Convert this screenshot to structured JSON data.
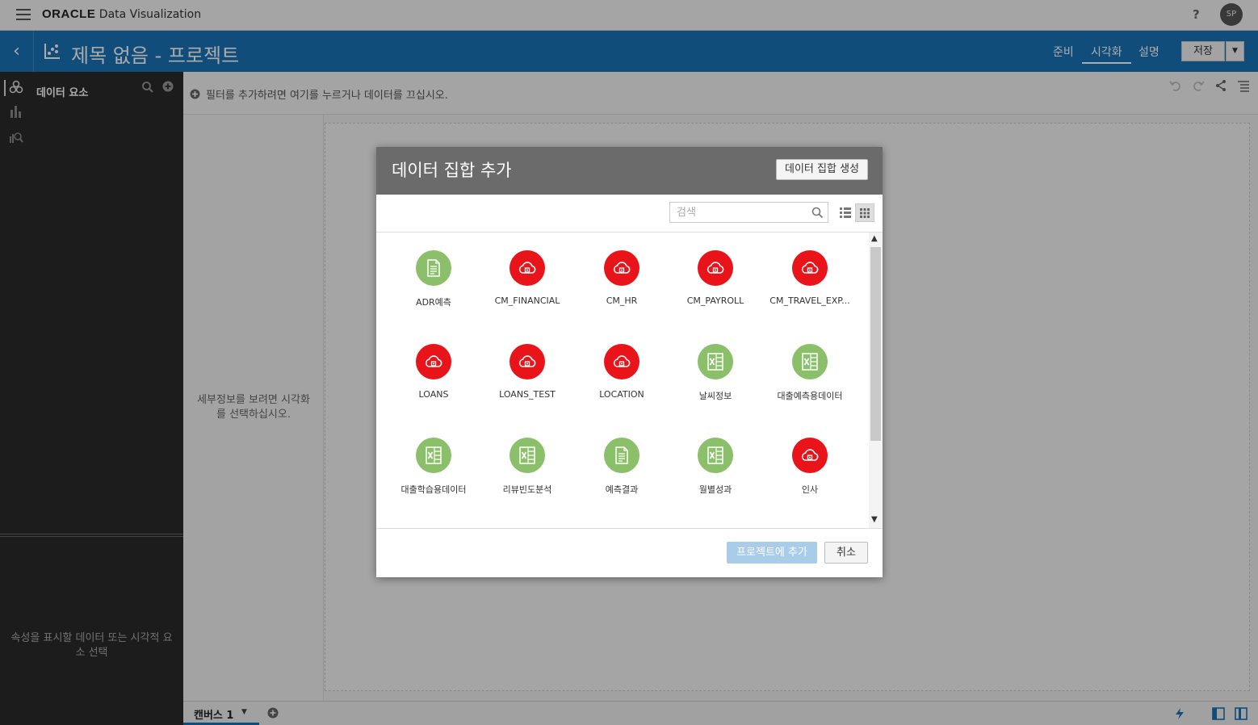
{
  "topbar": {
    "brand_oracle": "ORACLE",
    "brand_product": "Data Visualization",
    "help": "?",
    "avatar": "SP"
  },
  "titlebar": {
    "title": "제목 없음 - 프로젝트",
    "tabs": [
      {
        "label": "준비"
      },
      {
        "label": "시각화",
        "active": true
      },
      {
        "label": "설명"
      }
    ],
    "save_label": "저장",
    "save_caret": "▼"
  },
  "left_panel": {
    "section_label": "데이터 요소",
    "props_hint": "속성을 표시할 데이터 또는 시각적 요소 선택"
  },
  "filter_bar": {
    "hint": "필터를 추가하려면 여기를 누르거나 데이터를 끄십시오."
  },
  "details_pane": {
    "hint": "세부정보를 보려면 시각화를 선택하십시오."
  },
  "bottom_bar": {
    "canvas_tab": "캔버스 1",
    "caret": "▼"
  },
  "dialog": {
    "title": "데이터 집합 추가",
    "create_button": "데이터 집합 생성",
    "search_placeholder": "검색",
    "add_button": "프로젝트에 추가",
    "cancel_button": "취소",
    "datasets": [
      {
        "label": "ADR예측",
        "icon": "document-icon",
        "color": "#8bbf6a"
      },
      {
        "label": "CM_FINANCIAL",
        "icon": "cloud-icon",
        "color": "#e8141a"
      },
      {
        "label": "CM_HR",
        "icon": "cloud-icon",
        "color": "#e8141a"
      },
      {
        "label": "CM_PAYROLL",
        "icon": "cloud-icon",
        "color": "#e8141a"
      },
      {
        "label": "CM_TRAVEL_EXP...",
        "icon": "cloud-icon",
        "color": "#e8141a"
      },
      {
        "label": "LOANS",
        "icon": "cloud-icon",
        "color": "#e8141a"
      },
      {
        "label": "LOANS_TEST",
        "icon": "cloud-icon",
        "color": "#e8141a"
      },
      {
        "label": "LOCATION",
        "icon": "cloud-icon",
        "color": "#e8141a"
      },
      {
        "label": "날씨정보",
        "icon": "excel-icon",
        "color": "#8bbf6a"
      },
      {
        "label": "대출예측용데이터",
        "icon": "excel-icon",
        "color": "#8bbf6a"
      },
      {
        "label": "대출학습용데이터",
        "icon": "excel-icon",
        "color": "#8bbf6a"
      },
      {
        "label": "리뷰빈도분석",
        "icon": "excel-icon",
        "color": "#8bbf6a"
      },
      {
        "label": "예측결과",
        "icon": "document-icon",
        "color": "#8bbf6a"
      },
      {
        "label": "월별성과",
        "icon": "excel-icon",
        "color": "#8bbf6a"
      },
      {
        "label": "인사",
        "icon": "cloud-icon",
        "color": "#e8141a"
      }
    ]
  },
  "colors": {
    "accent": "#1a74b8",
    "cloud": "#e8141a",
    "file": "#8bbf6a"
  }
}
